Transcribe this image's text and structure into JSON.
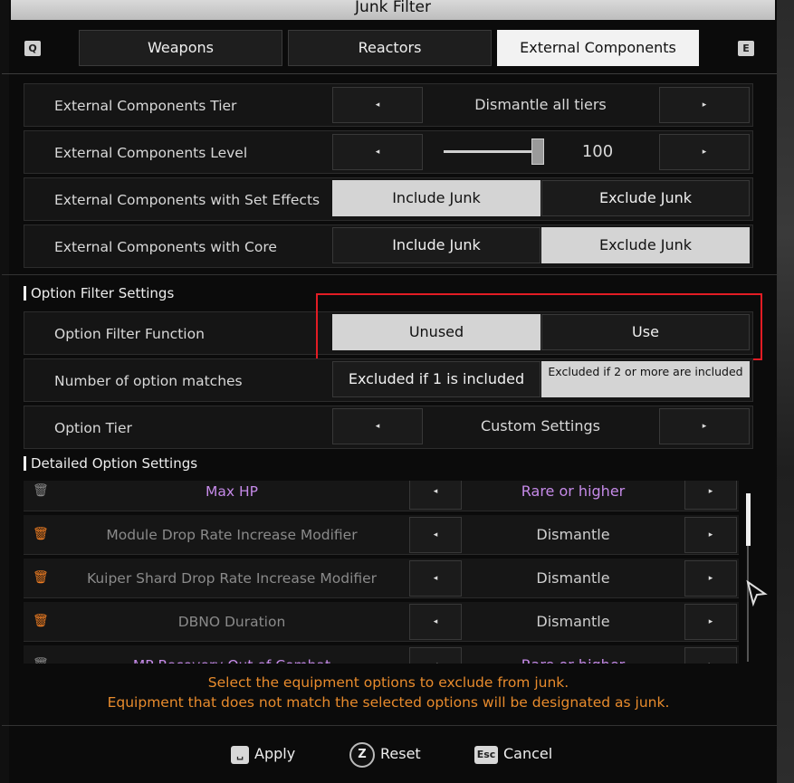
{
  "title": "Junk Filter",
  "keys": {
    "prev": "Q",
    "next": "E"
  },
  "tabs": [
    {
      "label": "Weapons",
      "active": false
    },
    {
      "label": "Reactors",
      "active": false
    },
    {
      "label": "External Components",
      "active": true
    }
  ],
  "filters": {
    "tier": {
      "label": "External Components Tier",
      "value": "Dismantle all tiers"
    },
    "level": {
      "label": "External Components Level",
      "value": "100"
    },
    "set_effects": {
      "label": "External Components with Set Effects",
      "include": "Include Junk",
      "exclude": "Exclude Junk",
      "selected": "include"
    },
    "core": {
      "label": "External Components with Core",
      "include": "Include Junk",
      "exclude": "Exclude Junk",
      "selected": "exclude"
    }
  },
  "option_filter": {
    "section_title": "Option Filter Settings",
    "function": {
      "label": "Option Filter Function",
      "unused": "Unused",
      "use": "Use",
      "selected": "unused"
    },
    "matches": {
      "label": "Number of option matches",
      "opt1": "Excluded if 1 is included",
      "opt2": "Excluded if 2 or more are included",
      "selected": "opt2"
    },
    "tier": {
      "label": "Option Tier",
      "value": "Custom Settings"
    }
  },
  "detailed": {
    "section_title": "Detailed Option Settings",
    "items": [
      {
        "name": "Max HP",
        "value": "Rare or higher",
        "highlight": true,
        "icon": "trash-disabled-icon"
      },
      {
        "name": "Module Drop Rate Increase Modifier",
        "value": "Dismantle",
        "highlight": false,
        "icon": "trash-icon"
      },
      {
        "name": "Kuiper Shard Drop Rate Increase Modifier",
        "value": "Dismantle",
        "highlight": false,
        "icon": "trash-icon"
      },
      {
        "name": "DBNO Duration",
        "value": "Dismantle",
        "highlight": false,
        "icon": "trash-icon"
      },
      {
        "name": "MP Recovery Out of Combat",
        "value": "Rare or higher",
        "highlight": true,
        "icon": "trash-disabled-icon"
      }
    ]
  },
  "hint": {
    "line1": "Select the equipment options to exclude from junk.",
    "line2": "Equipment that does not match the selected options will be designated as junk."
  },
  "footer": {
    "apply": {
      "key": "␣",
      "label": "Apply"
    },
    "reset": {
      "key": "Z",
      "label": "Reset"
    },
    "cancel": {
      "key": "Esc",
      "label": "Cancel"
    }
  },
  "colors": {
    "accent_purple": "#c58ae8",
    "hint_orange": "#e88b2c",
    "trash_orange": "#ef7d22",
    "highlight_red": "#e21c24"
  }
}
